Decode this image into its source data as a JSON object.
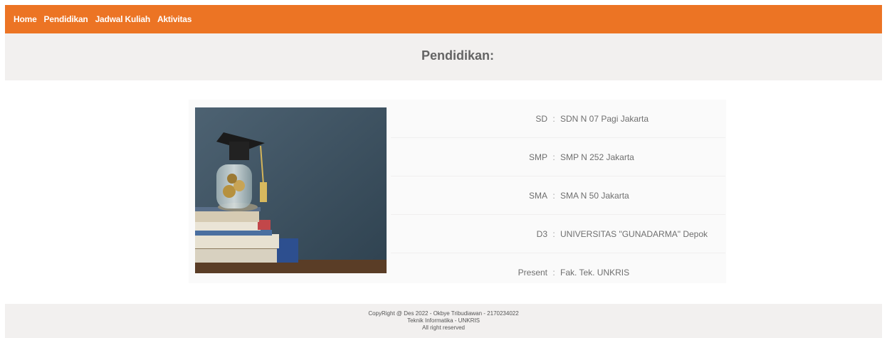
{
  "nav": {
    "items": [
      {
        "label": "Home"
      },
      {
        "label": "Pendidikan"
      },
      {
        "label": "Jadwal Kuliah"
      },
      {
        "label": "Aktivitas"
      }
    ]
  },
  "header": {
    "title": "Pendidikan:"
  },
  "education": {
    "separator": ":",
    "rows": [
      {
        "level": "SD",
        "school": "SDN N 07 Pagi Jakarta"
      },
      {
        "level": "SMP",
        "school": "SMP N 252 Jakarta"
      },
      {
        "level": "SMA",
        "school": "SMA N 50 Jakarta"
      },
      {
        "level": "D3",
        "school": "UNIVERSITAS \"GUNADARMA\" Depok"
      },
      {
        "level": "Present",
        "school": "Fak. Tek. UNKRIS"
      }
    ]
  },
  "footer": {
    "line1": "CopyRight @ Des 2022 - Okbye Tribudiawan - 2170234022",
    "line2": "Teknik Informatika - UNKRIS",
    "line3": "All right reserved"
  },
  "colors": {
    "nav_bg": "#ec7424",
    "header_bg": "#f2f0ef",
    "footer_bg": "#f2f0ef"
  },
  "icons": {
    "photo": "graduation-cap-books-image"
  }
}
